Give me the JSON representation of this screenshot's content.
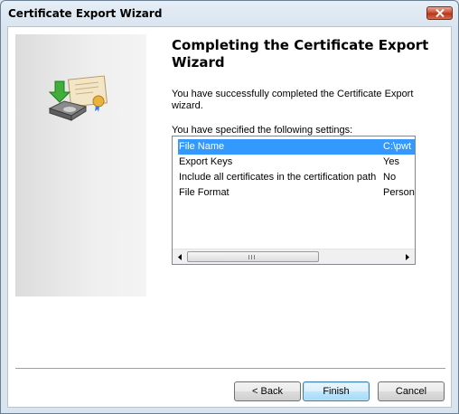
{
  "window": {
    "title": "Certificate Export Wizard"
  },
  "main": {
    "heading": "Completing the Certificate Export Wizard",
    "success_text": "You have successfully completed the Certificate Export wizard.",
    "settings_label": "You have specified the following settings:",
    "settings": [
      {
        "name": "File Name",
        "value": "C:\\pwt",
        "selected": true
      },
      {
        "name": "Export Keys",
        "value": "Yes",
        "selected": false
      },
      {
        "name": "Include all certificates in the certification path",
        "value": "No",
        "selected": false
      },
      {
        "name": "File Format",
        "value": "Person",
        "selected": false
      }
    ]
  },
  "buttons": {
    "back": "< Back",
    "finish": "Finish",
    "cancel": "Cancel"
  },
  "icons": {
    "side_panel": "certificate-export-icon",
    "close": "close-icon"
  },
  "colors": {
    "selection": "#3399ff",
    "close_button": "#c8472c"
  }
}
